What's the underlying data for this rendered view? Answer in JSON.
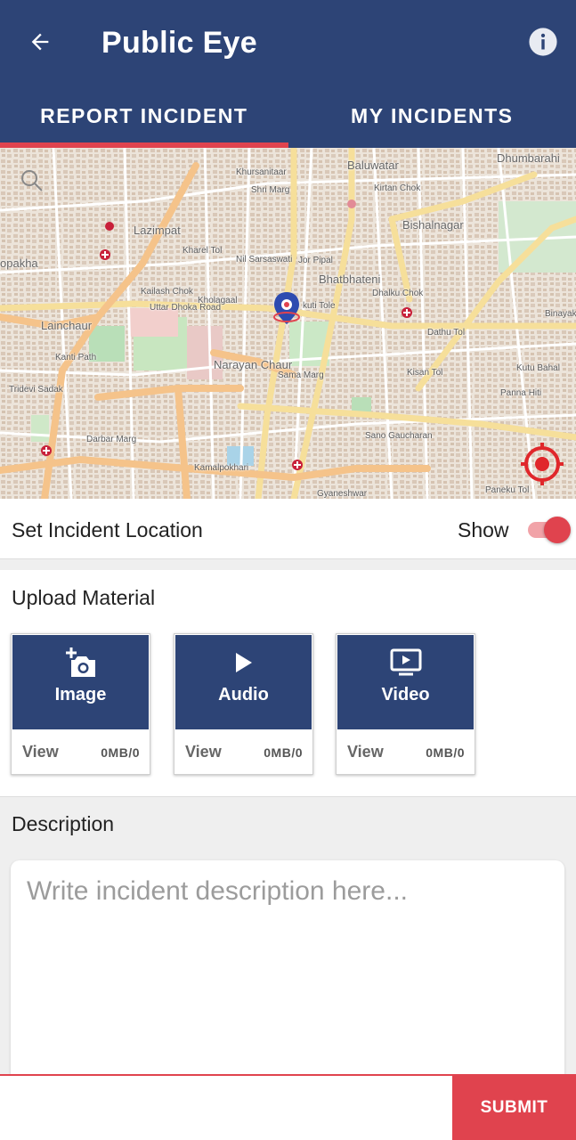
{
  "appbar": {
    "title": "Public Eye",
    "back_icon": "arrow-left-icon",
    "info_icon": "info-icon"
  },
  "tabs": [
    {
      "label": "REPORT INCIDENT",
      "active": true
    },
    {
      "label": "MY INCIDENTS",
      "active": false
    }
  ],
  "map": {
    "labels": {
      "baluwatar": "Baluwatar",
      "dhumbarahi": "Dhumbarahi",
      "khursanitaar": "Khursanitaar",
      "shri_marg": "Shri Marg",
      "kirtan_chok": "Kirtan Chok",
      "lazimpat": "Lazimpat",
      "bishalnagar": "Bishalnagar",
      "opakha": "opakha",
      "kharel_tol": "Kharel Tol",
      "nil_sarsaswati": "Nil Sarsaswati",
      "jor_pipal": "Jor Pipal",
      "bhatbhateni": "Bhatbhateni",
      "kailash_chok": "Kailash Chok",
      "kholagaal": "Kholagaal",
      "uttar_dhoka_road": "Uttar Dhoka Road",
      "kuti_tole": "kuti Tole",
      "dhalku_chok": "Dhalku Chok",
      "lainchaur": "Lainchaur",
      "dathu_tol": "Dathu Tol",
      "narayan_chaur": "Narayan Chaur",
      "sama_marg": "Sama Marg",
      "kisan_tol": "Kisan Tol",
      "kutu_bahal": "Kutu Bahal",
      "panna_hiti": "Panna Hiti",
      "tridevi_sadak": "Tridevi Sadak",
      "sano_gaucharan": "Sano Gaucharan",
      "kamalpokhari": "Kamalpokhari",
      "gyaneshwar": "Gyaneshwar",
      "paneku_tol": "Paneku Tol",
      "binayak": "Binayak",
      "darbar_marg": "Darbar Marg",
      "kanti_path": "Kanti Path"
    }
  },
  "location": {
    "label": "Set Incident Location",
    "toggle_label": "Show",
    "toggle_on": true
  },
  "upload": {
    "heading": "Upload Material",
    "items": [
      {
        "name": "Image",
        "icon": "add-photo-icon",
        "view": "View",
        "size": "0MB/0"
      },
      {
        "name": "Audio",
        "icon": "play-icon",
        "view": "View",
        "size": "0MB/0"
      },
      {
        "name": "Video",
        "icon": "video-screen-icon",
        "view": "View",
        "size": "0MB/0"
      }
    ]
  },
  "description": {
    "heading": "Description",
    "placeholder": "Write incident description here...",
    "value": ""
  },
  "submit": {
    "label": "SUBMIT"
  },
  "colors": {
    "primary": "#2d4476",
    "accent": "#e0434e"
  }
}
